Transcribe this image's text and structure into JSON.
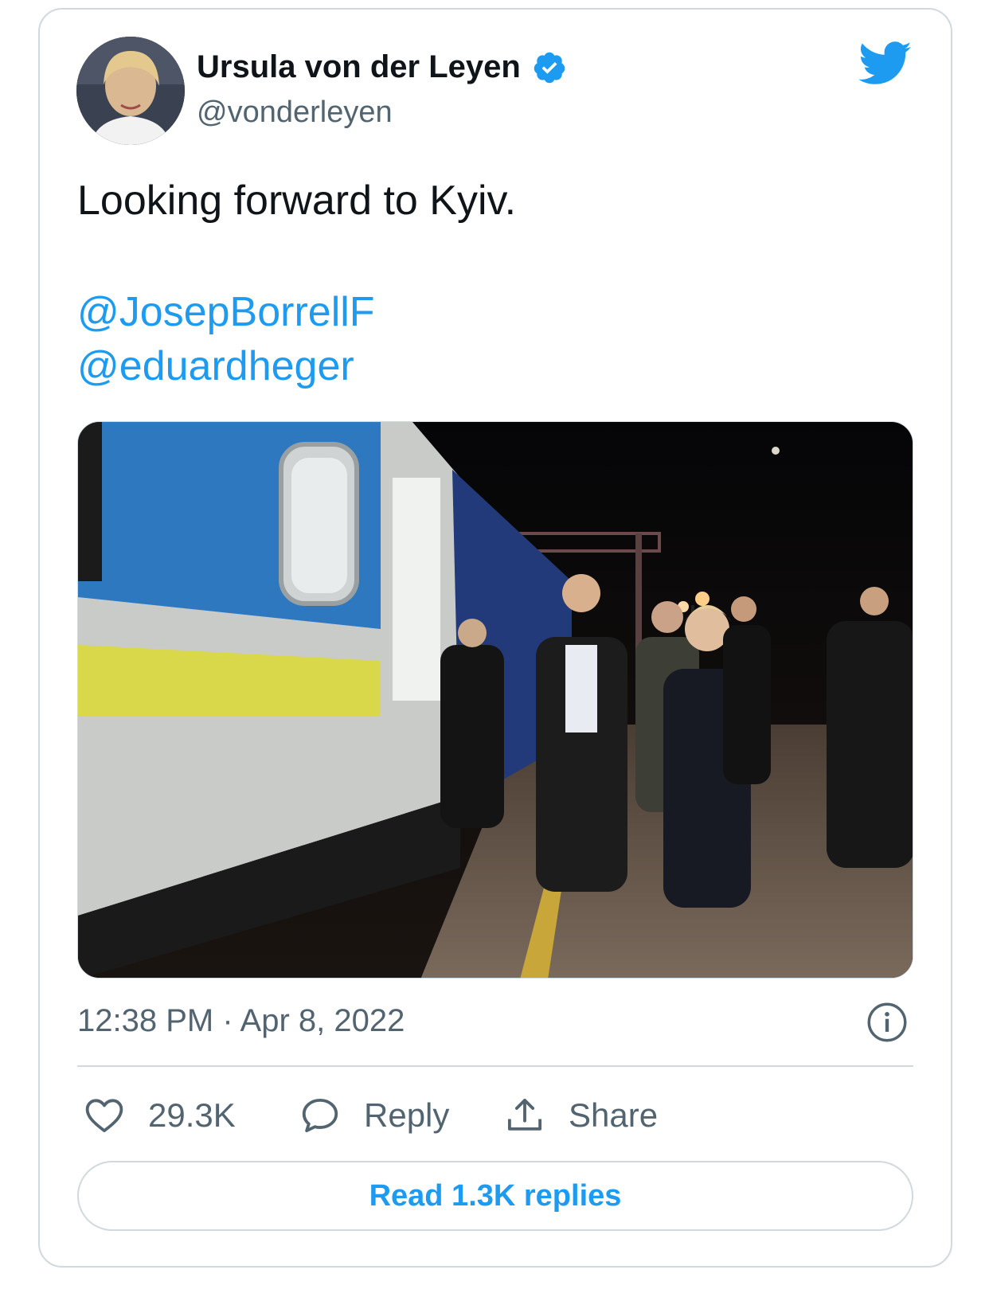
{
  "author": {
    "name": "Ursula von der Leyen",
    "handle": "@vonderleyen",
    "verified": true,
    "avatar_icon": "profile-photo"
  },
  "tweet": {
    "text": "Looking forward to Kyiv.",
    "mentions": [
      "@JosepBorrellF",
      "@eduardheger"
    ],
    "image_alt_icon": "train-platform-photo",
    "timestamp": "12:38 PM · Apr 8, 2022"
  },
  "actions": {
    "likes": "29.3K",
    "reply_label": "Reply",
    "share_label": "Share"
  },
  "read_replies_label": "Read 1.3K replies",
  "colors": {
    "accent": "#1d9bf0",
    "muted": "#536471",
    "border": "#cfd9de"
  }
}
